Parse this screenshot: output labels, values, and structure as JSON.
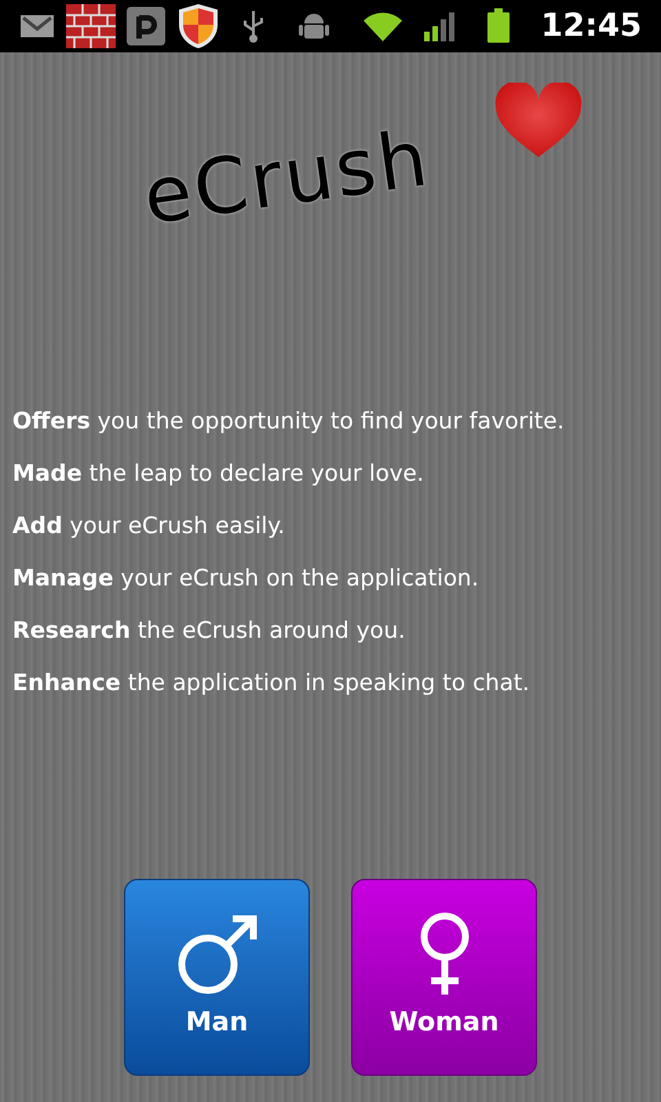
{
  "status_bar": {
    "time": "12:45"
  },
  "app": {
    "logo": "eCrush"
  },
  "features": [
    "**Offers** you the opportunity to find your favorite.",
    "**Made** the leap to declare your love.",
    "**Add** your eCrush easily.",
    "**Manage** your eCrush on the application.",
    "**Research** the eCrush around you.",
    "**Enhance** the application in speaking to chat."
  ],
  "buttons": [
    {
      "label": "Man",
      "kind": "male"
    },
    {
      "label": "Woman",
      "kind": "female"
    }
  ]
}
